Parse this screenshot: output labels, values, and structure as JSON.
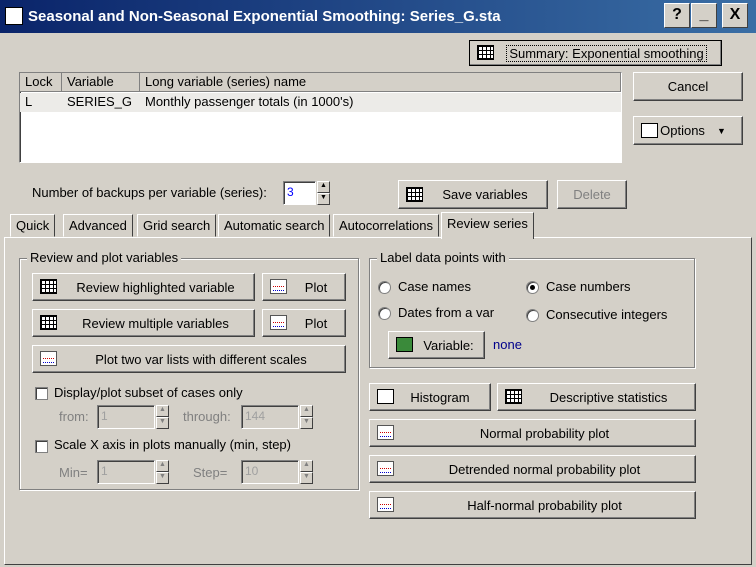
{
  "window": {
    "title": "Seasonal and Non-Seasonal Exponential Smoothing: Series_G.sta",
    "help": "?",
    "minimize": "_",
    "close": "X"
  },
  "summary_button": {
    "label": "Summary: Exponential smoothing"
  },
  "cancel_button": {
    "label": "Cancel"
  },
  "options_button": {
    "label": "Options"
  },
  "table": {
    "headers": [
      "Lock",
      "Variable",
      "Long variable (series) name"
    ],
    "rows": [
      {
        "lock": "L",
        "variable": "SERIES_G",
        "name": "Monthly passenger totals (in 1000's)"
      }
    ]
  },
  "backups": {
    "label": "Number of backups per variable (series):",
    "value": "3"
  },
  "save_button": {
    "label": "Save variables"
  },
  "delete_button": {
    "label": "Delete"
  },
  "tabs": [
    "Quick",
    "Advanced",
    "Grid search",
    "Automatic search",
    "Autocorrelations",
    "Review series"
  ],
  "review": {
    "group_title": "Review and plot variables",
    "highlighted": "Review highlighted variable",
    "multiple": "Review multiple variables",
    "plot": "Plot",
    "two_lists": "Plot two var lists with different scales",
    "subset_label": "Display/plot subset of cases only",
    "from_label": "from:",
    "from_value": "1",
    "through_label": "through:",
    "through_value": "144",
    "scale_label": "Scale X axis in plots manually (min, step)",
    "min_label": "Min=",
    "min_value": "1",
    "step_label": "Step=",
    "step_value": "10"
  },
  "labels": {
    "group_title": "Label data points with",
    "case_names": "Case names",
    "case_numbers": "Case numbers",
    "dates": "Dates from a var",
    "consecutive": "Consecutive integers",
    "variable_button": "Variable:",
    "variable_value": "none"
  },
  "stats": {
    "histogram": "Histogram",
    "descriptive": "Descriptive statistics",
    "normal": "Normal probability plot",
    "detrended": "Detrended normal probability plot",
    "half_normal": "Half-normal probability plot"
  }
}
